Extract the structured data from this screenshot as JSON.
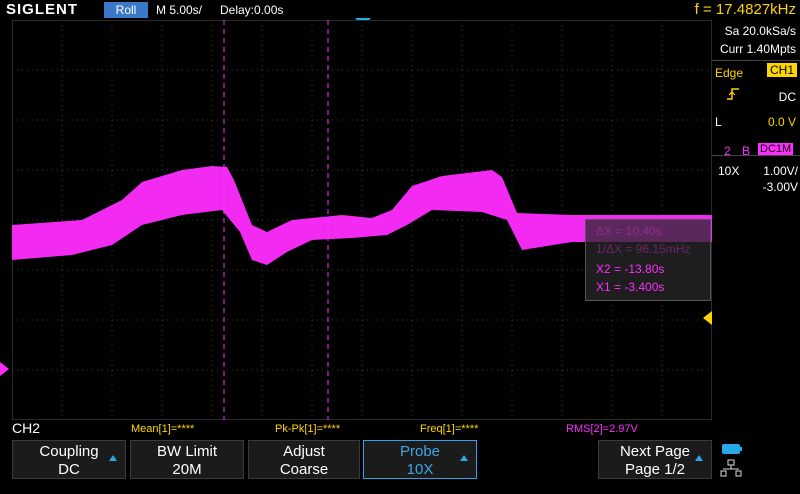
{
  "header": {
    "brand": "SIGLENT",
    "mode": "Roll",
    "timebase": "M 5.00s/",
    "delay": "Delay:0.00s",
    "frequency": "f = 17.4827kHz"
  },
  "acquisition": {
    "sample_rate": "Sa 20.0kSa/s",
    "memory_depth": "Curr 1.40Mpts"
  },
  "trigger": {
    "type_label": "Edge",
    "source": "CH1",
    "slope_icon": "rising-edge-icon",
    "coupling": "DC",
    "level_label": "L",
    "level": "0.0 V"
  },
  "channel2": {
    "number": "2",
    "bw_flag": "B",
    "coupling_tag": "DC1M",
    "probe": "10X",
    "scale": "1.00V/",
    "offset": "-3.00V"
  },
  "cursors": {
    "delta_x": "ΔX = 10.40s",
    "inv_delta_x": "1/ΔX = 96.15mHz",
    "x2": "X2 = -13.80s",
    "x1": "X1 = -3.400s"
  },
  "measurements": {
    "channel_label": "CH2",
    "mean": "Mean[1]=****",
    "pkpk": "Pk-Pk[1]=****",
    "freq": "Freq[1]=****",
    "rms": "RMS[2]=2.97V"
  },
  "softkeys": [
    {
      "line1": "Coupling",
      "line2": "DC"
    },
    {
      "line1": "BW Limit",
      "line2": "20M"
    },
    {
      "line1": "Adjust",
      "line2": "Coarse"
    },
    {
      "line1": "Probe",
      "line2": "10X"
    },
    {
      "line1": "Next Page",
      "line2": "Page 1/2"
    }
  ],
  "colors": {
    "ch1": "#ffd500",
    "ch2": "#ff2cff",
    "accent": "#27a8e8"
  }
}
